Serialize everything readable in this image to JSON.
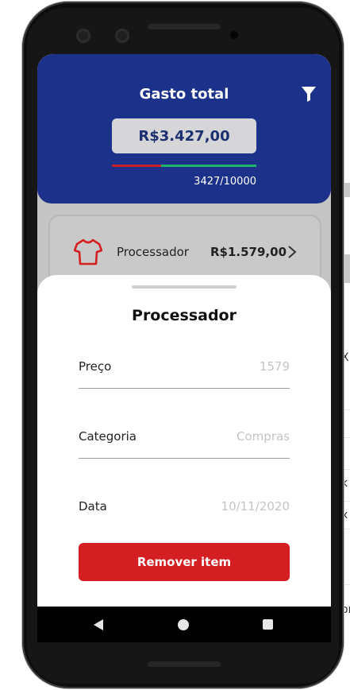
{
  "header": {
    "title": "Gasto total",
    "total": "R$3.427,00",
    "progress_text": "3427/10000",
    "progress_fraction": 0.3427,
    "colors": {
      "bg": "#1c318a",
      "spent": "#c81e2c",
      "remaining": "#1fb56f"
    }
  },
  "icons": {
    "filter": "filter-icon",
    "item": "shirt-icon",
    "chevron": "chevron-right-icon"
  },
  "item": {
    "name": "Processador",
    "price": "R$1.579,00"
  },
  "sheet": {
    "title": "Processador",
    "fields": [
      {
        "label": "Preço",
        "value": "1579"
      },
      {
        "label": "Categoria",
        "value": "Compras"
      },
      {
        "label": "Data",
        "value": "10/11/2020"
      }
    ],
    "remove_label": "Remover item",
    "remove_color": "#d41f22"
  },
  "background_fragments": [
    "X",
    "k",
    "x",
    "or"
  ]
}
